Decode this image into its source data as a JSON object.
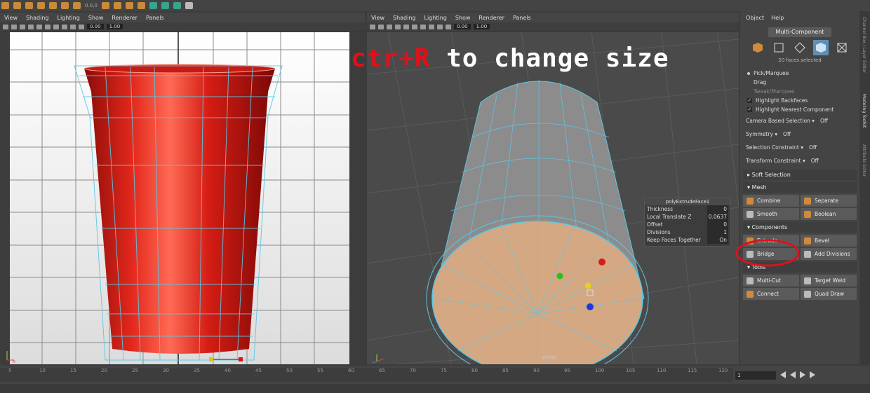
{
  "toolbar": {
    "snap_value": "0.0,0"
  },
  "left_viewport": {
    "menu": [
      "View",
      "Shading",
      "Lighting",
      "Show",
      "Renderer",
      "Panels"
    ],
    "field_a": "0.00",
    "field_b": "1.00",
    "axis_label": "x"
  },
  "right_viewport": {
    "menu": [
      "View",
      "Shading",
      "Lighting",
      "Show",
      "Renderer",
      "Panels"
    ],
    "field_a": "0.00",
    "field_b": "1.00",
    "camera_label": "persp"
  },
  "overlay": {
    "prefix": "ctr+R",
    "suffix": "to change size"
  },
  "extrude_box": {
    "title": "polyExtrudeFace1",
    "rows": [
      {
        "label": "Thickness",
        "value": "0"
      },
      {
        "label": "Local Translate Z",
        "value": "0.0637"
      },
      {
        "label": "Offset",
        "value": "0"
      },
      {
        "label": "Divisions",
        "value": "1"
      },
      {
        "label": "Keep Faces Together",
        "value": "On"
      }
    ]
  },
  "modeling_toolkit": {
    "menu": [
      "Object",
      "Help"
    ],
    "mode_title": "Multi-Component",
    "faces_selected": "20 faces selected",
    "pick_options": [
      "Pick/Marquee",
      "Drag",
      "Tweak/Marquee"
    ],
    "checks": [
      "Highlight Backfaces",
      "Highlight Nearest Component"
    ],
    "camera_based": {
      "label": "Camera Based Selection",
      "value": "Off"
    },
    "symmetry": {
      "label": "Symmetry",
      "value": "Off"
    },
    "selection_constraint": {
      "label": "Selection Constraint",
      "value": "Off"
    },
    "transform_constraint": {
      "label": "Transform Constraint",
      "value": "Off"
    },
    "soft_selection": "Soft Selection",
    "mesh_section": "Mesh",
    "mesh_buttons": [
      "Combine",
      "Separate",
      "Smooth",
      "Boolean"
    ],
    "components_section": "Components",
    "component_buttons": [
      "Extrude",
      "Bevel",
      "Bridge",
      "Add Divisions"
    ],
    "tools_section": "Tools",
    "tool_buttons": [
      "Multi-Cut",
      "Target Weld",
      "Connect",
      "Quad Draw"
    ]
  },
  "side_tabs": [
    "Channel Box / Layer Editor",
    "Modeling Toolkit",
    "Attribute Editor"
  ],
  "timeline": {
    "ticks": [
      "5",
      "10",
      "15",
      "20",
      "25",
      "30",
      "35",
      "40",
      "45",
      "50",
      "55",
      "60",
      "65",
      "70",
      "75",
      "80",
      "85",
      "90",
      "95",
      "100",
      "105",
      "110",
      "115",
      "120"
    ],
    "current_frame": "1"
  },
  "colors": {
    "accent_blue": "#5d8fb7",
    "highlight_red": "#e0101a",
    "cup_red": "#d8201a"
  }
}
